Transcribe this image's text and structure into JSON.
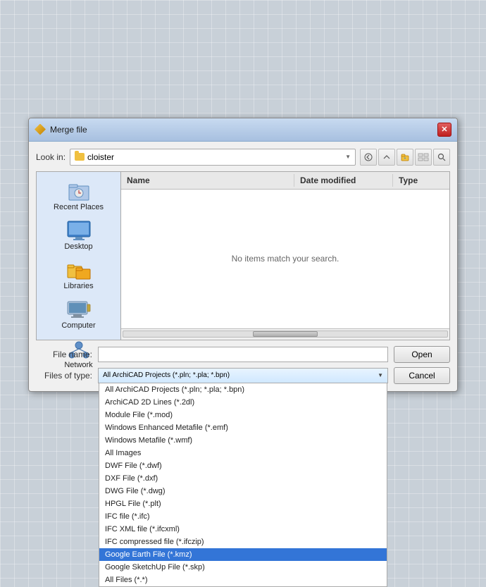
{
  "dialog": {
    "title": "Merge file",
    "title_icon": "merge-icon"
  },
  "toolbar": {
    "look_in_label": "Look in:",
    "current_folder": "cloister",
    "buttons": [
      "back",
      "up",
      "new-folder",
      "view",
      "search"
    ]
  },
  "file_list": {
    "col_name": "Name",
    "col_date": "Date modified",
    "col_type": "Type",
    "empty_message": "No items match your search."
  },
  "sidebar": {
    "items": [
      {
        "id": "recent-places",
        "label": "Recent Places"
      },
      {
        "id": "desktop",
        "label": "Desktop"
      },
      {
        "id": "libraries",
        "label": "Libraries"
      },
      {
        "id": "computer",
        "label": "Computer"
      },
      {
        "id": "network",
        "label": "Network"
      }
    ]
  },
  "form": {
    "file_name_label": "File name:",
    "file_name_value": "",
    "file_name_placeholder": "",
    "files_of_type_label": "Files of type:",
    "files_of_type_value": "All ArchiCAD Projects (*.pln; *.pla; *.bpn)",
    "open_label": "Open",
    "cancel_label": "Cancel"
  },
  "dropdown_options": [
    {
      "label": "All ArchiCAD Projects (*.pln; *.pla; *.bpn)",
      "selected": false
    },
    {
      "label": "ArchiCAD 2D Lines (*.2dl)",
      "selected": false
    },
    {
      "label": "Module File (*.mod)",
      "selected": false
    },
    {
      "label": "Windows Enhanced Metafile (*.emf)",
      "selected": false
    },
    {
      "label": "Windows Metafile (*.wmf)",
      "selected": false
    },
    {
      "label": "All Images",
      "selected": false
    },
    {
      "label": "DWF File (*.dwf)",
      "selected": false
    },
    {
      "label": "DXF File (*.dxf)",
      "selected": false
    },
    {
      "label": "DWG File (*.dwg)",
      "selected": false
    },
    {
      "label": "HPGL File (*.plt)",
      "selected": false
    },
    {
      "label": "IFC file (*.ifc)",
      "selected": false
    },
    {
      "label": "IFC XML file (*.ifcxml)",
      "selected": false
    },
    {
      "label": "IFC compressed file (*.ifczip)",
      "selected": false
    },
    {
      "label": "Google Earth File (*.kmz)",
      "selected": true
    },
    {
      "label": "Google SketchUp File (*.skp)",
      "selected": false
    },
    {
      "label": "All Files (*.*)",
      "selected": false
    }
  ]
}
